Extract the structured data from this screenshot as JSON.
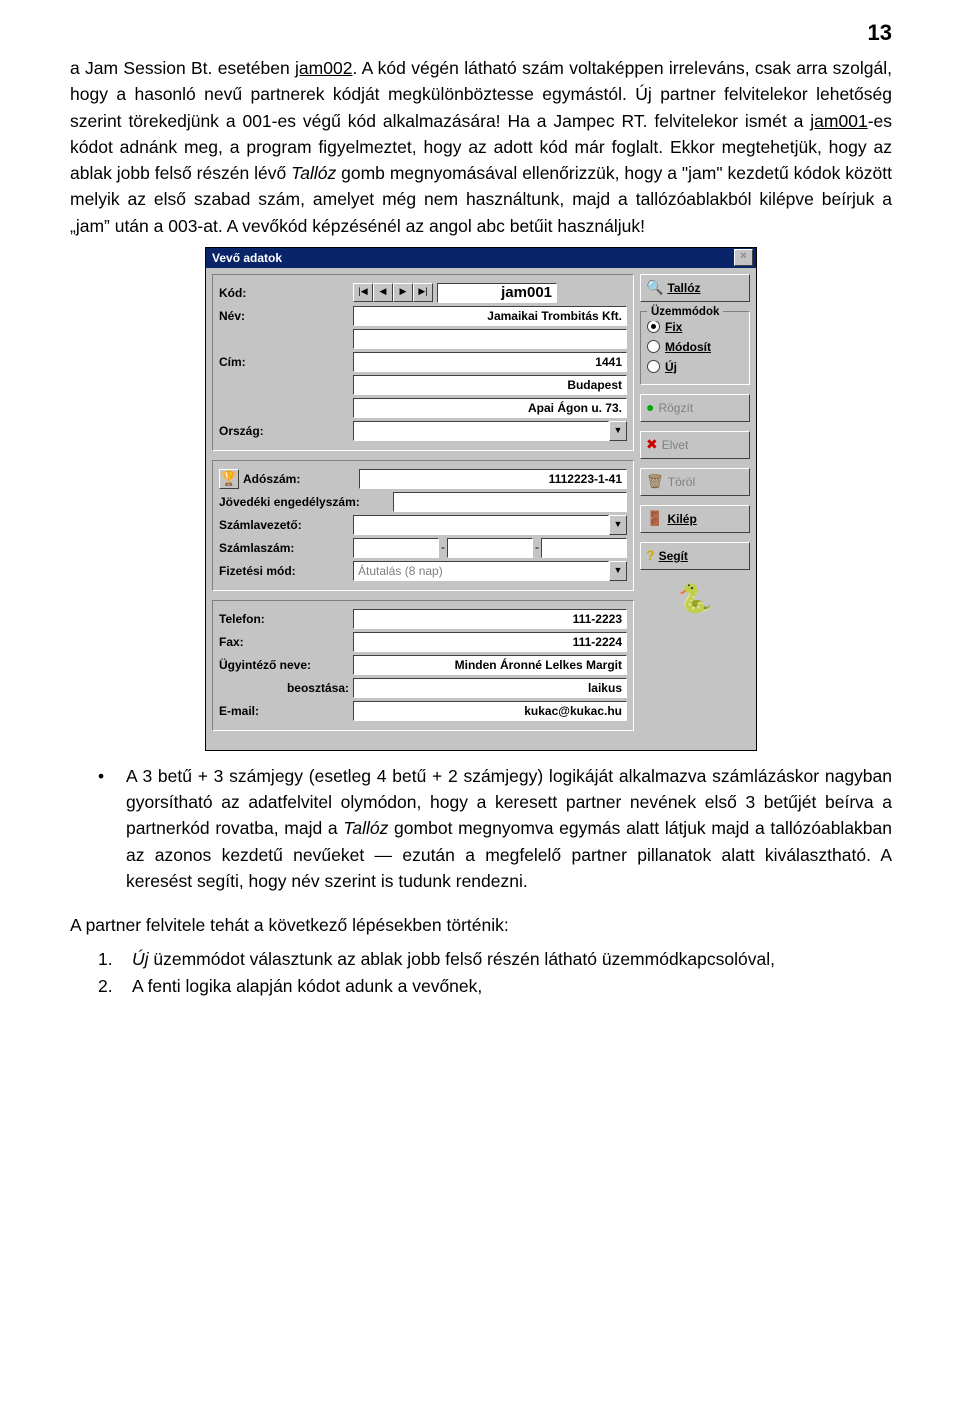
{
  "page_number": "13",
  "para1_a": "a Jam Session Bt. esetében ",
  "para1_link1": "jam002",
  "para1_b": ". A kód végén látható szám voltaképpen irreleváns, csak arra szolgál, hogy a hasonló nevű partnerek kódját megkülönböztesse egymástól. Új partner felvitelekor lehetőség szerint törekedjünk a 001-es végű kód alkalmazására! Ha a Jampec RT. felvitelekor ismét a ",
  "para1_link2": "jam001",
  "para1_c": "-es kódot adnánk meg, a program figyelmeztet, hogy az adott kód már foglalt. Ekkor megtehetjük, hogy az ablak jobb felső részén lévő ",
  "para1_em": "Tallóz",
  "para1_d": " gomb megnyomásával ellenőrizzük, hogy a \"jam\" kezdetű kódok között melyik az első szabad szám, amelyet még nem használtunk, majd a tallózóablakból kilépve beírjuk a „jam” után a 003-at. A vevőkód képzésénél az angol abc betűit használjuk!",
  "bullet_a": "A 3 betű + 3 számjegy (esetleg 4 betű + 2 számjegy) logikáját alkalmazva számlázáskor nagyban gyorsítható az adatfelvitel olymódon, hogy a keresett partner nevének első 3 betűjét beírva a partnerkód rovatba, majd a ",
  "bullet_em": "Tallóz",
  "bullet_b": " gombot megnyomva egymás alatt látjuk majd a tallózóablakban az azonos kezdetű nevűeket — ezután a megfelelő partner pillanatok alatt kiválasztható. A keresést segíti, hogy név szerint is tudunk rendezni.",
  "closing": "A partner felvitele tehát a következő lépésekben történik:",
  "item1_em": "Új",
  "item1": " üzemmódot választunk az ablak jobb felső részén látható üzemmódkapcsolóval,",
  "item2": "A fenti logika alapján kódot adunk a vevőnek,",
  "dialog": {
    "title": "Vevő adatok",
    "labels": {
      "kod": "Kód:",
      "nev": "Név:",
      "cim": "Cím:",
      "orszag": "Ország:",
      "adoszam": "Adószám:",
      "jovedeki": "Jövedéki engedélyszám:",
      "szamlavezeto": "Számlavezető:",
      "szamlaszam": "Számlaszám:",
      "fizetesimod": "Fizetési mód:",
      "telefon": "Telefon:",
      "fax": "Fax:",
      "ugyintezo": "Ügyintéző neve:",
      "beosztas": "beosztása:",
      "email": "E-mail:"
    },
    "values": {
      "kod": "jam001",
      "nev": "Jamaikai Trombitás Kft.",
      "irsz": "1441",
      "varos": "Budapest",
      "utca": "Apai Ágon  u. 73.",
      "adoszam": "1112223-1-41",
      "jovedeki": "",
      "szamlavezeto": "",
      "szamlaszam1": "",
      "szamlaszam2": "",
      "szamlaszam3": "",
      "fizetesimod": "Átutalás (8 nap)",
      "telefon": "111-2223",
      "fax": "111-2224",
      "ugyintezo": "Minden Áronné Lelkes Margit",
      "beosztas": "laikus",
      "email": "kukac@kukac.hu"
    },
    "buttons": {
      "talloz": "Tallóz",
      "rogzit": "Rögzít",
      "elvet": "Elvet",
      "torol": "Töröl",
      "kilep": "Kilép",
      "segit": "Segít"
    },
    "modes": {
      "legend": "Üzemmódok",
      "fix": "Fix",
      "modosit": "Módosít",
      "uj": "Új"
    },
    "nav": {
      "first": "|◀",
      "prev": "◀",
      "next": "▶",
      "last": "▶|"
    }
  }
}
